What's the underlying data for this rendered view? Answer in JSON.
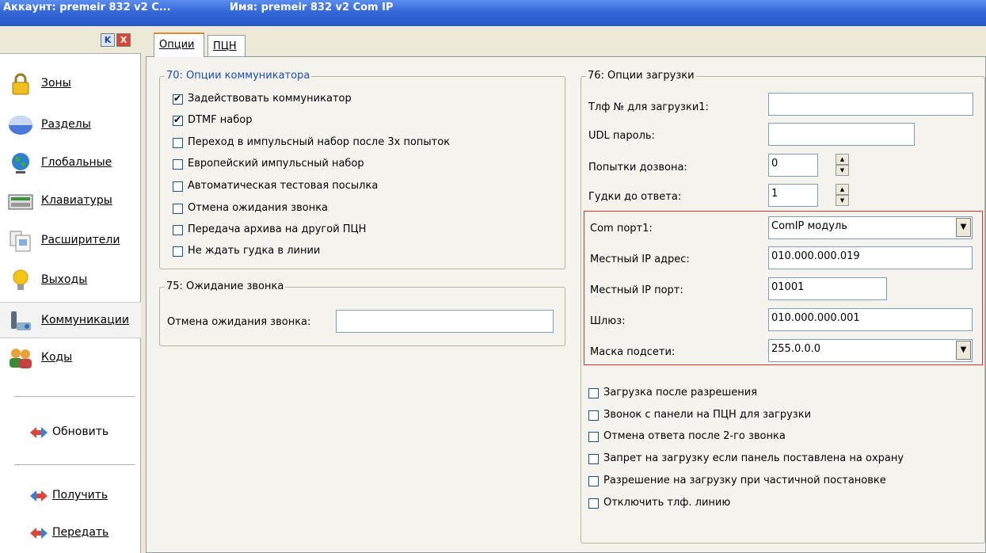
{
  "titlebar": {
    "account": "Аккаунт: premeir 832 v2 C...",
    "name": "Имя: premeir 832 v2 Com IP"
  },
  "sidebar": {
    "header_buttons": [
      "K",
      "X"
    ],
    "items": [
      {
        "label": "Зоны",
        "icon": "lock-icon"
      },
      {
        "label": "Разделы",
        "icon": "partition-icon"
      },
      {
        "label": "Глобальные",
        "icon": "globe-icon"
      },
      {
        "label": "Клавиатуры",
        "icon": "keyboard-icon"
      },
      {
        "label": "Расширители",
        "icon": "expander-icon"
      },
      {
        "label": "Выходы",
        "icon": "bulb-icon"
      },
      {
        "label": "Коммуникации",
        "icon": "phone-icon"
      },
      {
        "label": "Коды",
        "icon": "users-icon"
      }
    ],
    "actions": {
      "refresh": "Обновить",
      "receive": "Получить",
      "send": "Передать"
    }
  },
  "tabs": [
    "Опции",
    "ПЦН"
  ],
  "comm_options": {
    "title": "70: Опции коммуникатора",
    "checkboxes": [
      {
        "label": "Задействовать коммуникатор",
        "checked": true
      },
      {
        "label": "DTMF набор",
        "checked": true
      },
      {
        "label": "Переход в импульсный набор после 3х попыток",
        "checked": false
      },
      {
        "label": "Европейский импульсный набор",
        "checked": false
      },
      {
        "label": "Автоматическая тестовая посылка",
        "checked": false
      },
      {
        "label": "Отмена ожидания звонка",
        "checked": false
      },
      {
        "label": "Передача архива на другой ПЦН",
        "checked": false
      },
      {
        "label": "Не ждать гудка в линии",
        "checked": false
      }
    ]
  },
  "ring_wait": {
    "title": "75: Ожидание звонка",
    "label": "Отмена ожидания звонка:",
    "value": ""
  },
  "upload_options": {
    "title": "76: Опции загрузки",
    "phone_label": "Тлф № для загрузки1:",
    "phone_value": "",
    "udl_label": "UDL пароль:",
    "udl_value": "",
    "attempts_label": "Попытки дозвона:",
    "attempts_value": "0",
    "rings_label": "Гудки до ответа:",
    "rings_value": "1",
    "com_label": "Com порт1:",
    "com_value": "ComIP модуль",
    "ip_label": "Местный IP адрес:",
    "ip_value": "010.000.000.019",
    "port_label": "Местный IP порт:",
    "port_value": "01001",
    "gateway_label": "Шлюз:",
    "gateway_value": "010.000.000.001",
    "mask_label": "Маска подсети:",
    "mask_value": "255.0.0.0",
    "checkboxes": [
      {
        "label": "Загрузка после разрешения",
        "checked": false
      },
      {
        "label": "Звонок с панели на ПЦН для загрузки",
        "checked": false
      },
      {
        "label": "Отмена ответа после 2-го звонка",
        "checked": false
      },
      {
        "label": "Запрет на загрузку если панель поставлена на охрану",
        "checked": false
      },
      {
        "label": "Разрешение на загрузку при частичной постановке",
        "checked": false
      },
      {
        "label": "Отключить тлф. линию",
        "checked": false
      }
    ]
  },
  "colors": {
    "accent": "#2457c8",
    "highlight": "#e03030",
    "group_title": "#1a4cb5"
  }
}
